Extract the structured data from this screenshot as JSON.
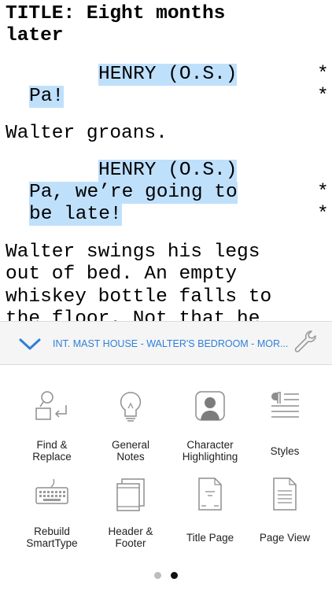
{
  "script": {
    "title_line_1": "TITLE: Eight months",
    "title_line_2": "later",
    "character_1": "HENRY (O.S.)",
    "dialogue_1": "Pa!",
    "action_1": "Walter groans.",
    "character_2": "HENRY (O.S.)",
    "dialogue_2_line_1": "Pa, we’re going to",
    "dialogue_2_line_2": "be late!",
    "action_2_line_1": "Walter swings his legs",
    "action_2_line_2": "out of bed. An empty",
    "action_2_line_3": "whiskey bottle falls to",
    "action_2_line_4": "the floor. Not that he",
    "revision_mark": "*"
  },
  "scene_bar": {
    "scene_heading": "INT. MAST HOUSE - WALTER'S BEDROOM - MOR...",
    "accent_color": "#2f7fd7"
  },
  "tools": [
    {
      "icon": "find-replace-icon",
      "label_1": "Find &",
      "label_2": "Replace"
    },
    {
      "icon": "lightbulb-icon",
      "label_1": "General",
      "label_2": "Notes"
    },
    {
      "icon": "character-portrait-icon",
      "label_1": "Character",
      "label_2": "Highlighting"
    },
    {
      "icon": "pilcrow-icon",
      "label_1": "Styles"
    },
    {
      "icon": "keyboard-icon",
      "label_1": "Rebuild",
      "label_2": "SmartType"
    },
    {
      "icon": "header-footer-icon",
      "label_1": "Header &",
      "label_2": "Footer"
    },
    {
      "icon": "title-page-icon",
      "label_1": "Title Page"
    },
    {
      "icon": "page-view-icon",
      "label_1": "Page View"
    }
  ],
  "pager": {
    "page_count": 2,
    "current_page": 2
  },
  "colors": {
    "highlight": "#bfe0fb",
    "icon_gray": "#8e8e8e"
  }
}
